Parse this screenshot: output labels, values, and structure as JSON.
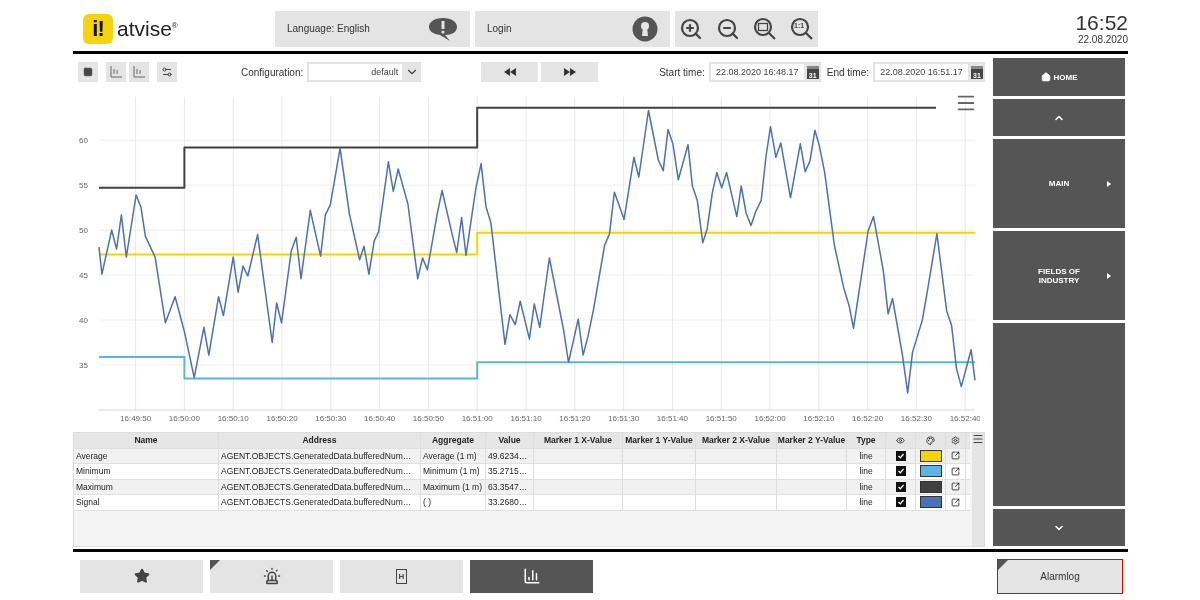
{
  "header": {
    "logo": {
      "badge": "i!",
      "name": "atvise",
      "mark": "®"
    },
    "language": "Language: English",
    "login": "Login",
    "zoom_tools": [
      {
        "kind": "in"
      },
      {
        "kind": "out"
      },
      {
        "kind": "fit"
      },
      {
        "kind": "reset",
        "glyph": "1:1"
      }
    ],
    "clock": {
      "time": "16:52",
      "date": "22.08.2020"
    }
  },
  "toolbar": {
    "configuration": {
      "label": "Configuration:",
      "value": "default"
    },
    "start_time": {
      "label": "Start time:",
      "value": "22.08.2020 16:48.17",
      "calendar": "31"
    },
    "end_time": {
      "label": "End time:",
      "value": "22.08.2020 16:51.17",
      "calendar": "31"
    }
  },
  "chart_data": {
    "type": "line",
    "grid": true,
    "xlim": [
      60582.5,
      60762
    ],
    "ylim": [
      30,
      64.8
    ],
    "xticks": [
      {
        "value": 60590,
        "label": "16:49:50"
      },
      {
        "value": 60600,
        "label": "16:50:00"
      },
      {
        "value": 60610,
        "label": "16:50:10"
      },
      {
        "value": 60620,
        "label": "16:50:20"
      },
      {
        "value": 60630,
        "label": "16:50:30"
      },
      {
        "value": 60640,
        "label": "16:50:40"
      },
      {
        "value": 60650,
        "label": "16:50:50"
      },
      {
        "value": 60660,
        "label": "16:51:00"
      },
      {
        "value": 60670,
        "label": "16:51:10"
      },
      {
        "value": 60680,
        "label": "16:51:20"
      },
      {
        "value": 60690,
        "label": "16:51:30"
      },
      {
        "value": 60700,
        "label": "16:51:40"
      },
      {
        "value": 60710,
        "label": "16:51:50"
      },
      {
        "value": 60720,
        "label": "16:52:00"
      },
      {
        "value": 60730,
        "label": "16:52:10"
      },
      {
        "value": 60740,
        "label": "16:52:20"
      },
      {
        "value": 60750,
        "label": "16:52:30"
      },
      {
        "value": 60760,
        "label": "16:52:40"
      }
    ],
    "yticks": [
      35,
      40,
      45,
      50,
      55,
      60
    ],
    "series": [
      {
        "color": "#f2d600",
        "x": [
          60582.5,
          60660,
          60660,
          60762
        ],
        "values": [
          47.3,
          47.3,
          49.7,
          49.7
        ]
      },
      {
        "color": "#5ab4e6",
        "x": [
          60582.5,
          60600,
          60600,
          60660,
          60660,
          60762
        ],
        "values": [
          35.9,
          35.9,
          33.5,
          33.5,
          35.3,
          35.3
        ]
      },
      {
        "color": "#404040",
        "x": [
          60582.5,
          60600,
          60600,
          60660,
          60660,
          60754
        ],
        "values": [
          54.7,
          54.7,
          59.2,
          59.2,
          63.6,
          63.6
        ]
      },
      {
        "color": "#4a72b5",
        "x": [
          60582.5,
          60583.1,
          60585.1,
          60586.1,
          60587.1,
          60588.1,
          60590.1,
          60591.1,
          60592,
          60594,
          60596.1,
          60598.1,
          60600,
          60602,
          60604,
          60605,
          60607,
          60608,
          60610,
          60611,
          60612,
          60613,
          60615,
          60618,
          60618.9,
          60619.9,
          60621.9,
          60622.9,
          60623.9,
          60625.8,
          60627.9,
          60628.9,
          60629.9,
          60631.9,
          60633.8,
          60635.9,
          60636.8,
          60637.8,
          60638.9,
          60639.8,
          60641.8,
          60642.8,
          60643.8,
          60645.8,
          60647.8,
          60648.8,
          60649.8,
          60651.8,
          60652.8,
          60654.8,
          60655.8,
          60656.8,
          60657.7,
          60659.7,
          60660.8,
          60661.8,
          60662.8,
          60665.7,
          60666.7,
          60667.8,
          60668.8,
          60670.7,
          60671.7,
          60672.8,
          60674.8,
          60677.7,
          60678.7,
          60680.7,
          60681.7,
          60682.7,
          60683.8,
          60686.1,
          60687.1,
          60688.1,
          60690.1,
          60692.1,
          60693.1,
          60695.1,
          60697.1,
          60698.1,
          60699.1,
          60700.1,
          60701.2,
          60703.2,
          60704.1,
          60705.1,
          60706.2,
          60707.1,
          60708.2,
          60709.1,
          60710.1,
          60711.1,
          60713.2,
          60714.1,
          60715.1,
          60716.1,
          60717.1,
          60718.2,
          60719.2,
          60720.1,
          60721.2,
          60722.2,
          60724.2,
          60726.2,
          60727.2,
          60728.2,
          60729.2,
          60730.1,
          60731.2,
          60733.2,
          60735.1,
          60736.2,
          60737.1,
          60739.2,
          60740.1,
          60741.2,
          60743.2,
          60744.2,
          60745.1,
          60747.1,
          60748.2,
          60749.2,
          60751.2,
          60752.2,
          60754.2,
          60756.2,
          60757.2,
          60758.2,
          60759.2,
          60761.2,
          60762
        ],
        "values": [
          48.1,
          45.1,
          50,
          47.9,
          51.7,
          47,
          53.9,
          52.5,
          49.3,
          47,
          39.7,
          42.6,
          38.7,
          33.6,
          39.2,
          36.1,
          42.6,
          40.5,
          47,
          43.1,
          46,
          44.9,
          49.5,
          37.5,
          41.9,
          39.7,
          47.7,
          49.2,
          44.6,
          52.2,
          47.1,
          51.7,
          52.8,
          59.1,
          51.8,
          46.7,
          48.2,
          45.1,
          48.8,
          49.8,
          57.6,
          54.3,
          56.8,
          52.9,
          44.6,
          46.9,
          45.6,
          51.8,
          54.4,
          49.7,
          47.5,
          51.4,
          47.2,
          54.6,
          57.4,
          52.6,
          50.8,
          37.3,
          40.6,
          39.5,
          42.1,
          37.9,
          41.8,
          39.2,
          46.9,
          38.9,
          35.3,
          40.1,
          36.1,
          38.2,
          41.1,
          48.3,
          49.6,
          54.2,
          51.2,
          58.1,
          55.9,
          63.3,
          57.8,
          56.6,
          61.2,
          59.6,
          55.6,
          59.5,
          54.9,
          53.3,
          48.6,
          50.1,
          54.2,
          56.4,
          54.7,
          56.4,
          51.5,
          54.9,
          51.9,
          50.5,
          52.1,
          53.3,
          58.3,
          61.5,
          58.1,
          59.7,
          53.6,
          59.6,
          56.5,
          57.7,
          61.1,
          59.4,
          56.4,
          48.3,
          43.6,
          41.6,
          39.1,
          46.6,
          49.9,
          51.5,
          45.5,
          40.7,
          42.4,
          36.2,
          31.9,
          36.4,
          40,
          43.1,
          49.6,
          41,
          39.4,
          34.6,
          32.6,
          36.7,
          33.3
        ]
      }
    ]
  },
  "table": {
    "columns": [
      "Name",
      "Address",
      "Aggregate",
      "Value",
      "Marker 1 X-Value",
      "Marker 1 Y-Value",
      "Marker 2 X-Value",
      "Marker 2 Y-Value",
      "Type"
    ],
    "rows": [
      {
        "name": "Average",
        "address": "AGENT.OBJECTS.GeneratedData.bufferedNum…",
        "aggregate": "Average (1 m)",
        "value": "49.6234…",
        "type": "line",
        "visible": true,
        "color": "#f2d600"
      },
      {
        "name": "Minimum",
        "address": "AGENT.OBJECTS.GeneratedData.bufferedNum…",
        "aggregate": "Minimum (1 m)",
        "value": "35.2715…",
        "type": "line",
        "visible": true,
        "color": "#5ab4e6"
      },
      {
        "name": "Maximum",
        "address": "AGENT.OBJECTS.GeneratedData.bufferedNum…",
        "aggregate": "Maximum (1 m)",
        "value": "63.3547…",
        "type": "line",
        "visible": true,
        "color": "#404040"
      },
      {
        "name": "Signal",
        "address": "AGENT.OBJECTS.GeneratedData.bufferedNum…",
        "aggregate": "( )",
        "value": "33.2680…",
        "type": "line",
        "visible": true,
        "color": "#4a72b5"
      }
    ]
  },
  "nav": [
    {
      "kind": "home",
      "label": "HOME"
    },
    {
      "kind": "up"
    },
    {
      "kind": "menu",
      "label": "MAIN"
    },
    {
      "kind": "menu",
      "label": "FIELDS OF INDUSTRY"
    },
    {
      "kind": "blank"
    },
    {
      "kind": "down"
    }
  ],
  "bottom_buttons": [
    {
      "kind": "favorites",
      "selected": false,
      "flagged": false
    },
    {
      "kind": "alarms",
      "selected": false,
      "flagged": true
    },
    {
      "kind": "document",
      "glyph": "H",
      "selected": false,
      "flagged": false
    },
    {
      "kind": "trend",
      "selected": true,
      "flagged": false
    }
  ],
  "alarmlog": {
    "label": "Alarmlog",
    "alert": true,
    "flagged": true
  }
}
